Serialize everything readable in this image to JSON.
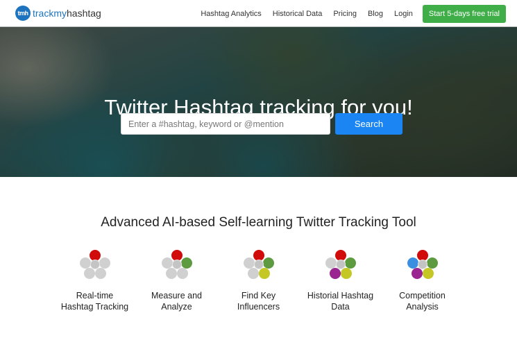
{
  "nav": {
    "logo_badge": "tmh",
    "logo_text_a": "trackmy",
    "logo_text_b": "hashtag",
    "links": [
      "Hashtag Analytics",
      "Historical Data",
      "Pricing",
      "Blog",
      "Login"
    ],
    "cta": "Start 5-days free trial"
  },
  "hero": {
    "title": "Twitter Hashtag tracking for you!",
    "search_placeholder": "Enter a #hashtag, keyword or @mention",
    "search_value": "",
    "search_button": "Search"
  },
  "section": {
    "title": "Advanced AI-based Self-learning Twitter Tracking Tool"
  },
  "features": [
    {
      "line1": "Real-time",
      "line2": "Hashtag Tracking",
      "colors": [
        "#d10a0a",
        "#d0d0d0",
        "#d0d0d0",
        "#d0d0d0",
        "#d0d0d0"
      ]
    },
    {
      "line1": "Measure and",
      "line2": "Analyze",
      "colors": [
        "#d10a0a",
        "#5d9a40",
        "#d0d0d0",
        "#d0d0d0",
        "#d0d0d0"
      ]
    },
    {
      "line1": "Find Key",
      "line2": "Influencers",
      "colors": [
        "#d10a0a",
        "#5d9a40",
        "#c5c824",
        "#d0d0d0",
        "#d0d0d0"
      ]
    },
    {
      "line1": "Historial Hashtag",
      "line2": "Data",
      "colors": [
        "#d10a0a",
        "#5d9a40",
        "#c5c824",
        "#9a2490",
        "#d0d0d0"
      ]
    },
    {
      "line1": "Competition",
      "line2": "Analysis",
      "colors": [
        "#d10a0a",
        "#5d9a40",
        "#c5c824",
        "#9a2490",
        "#3b8fe0"
      ]
    }
  ]
}
